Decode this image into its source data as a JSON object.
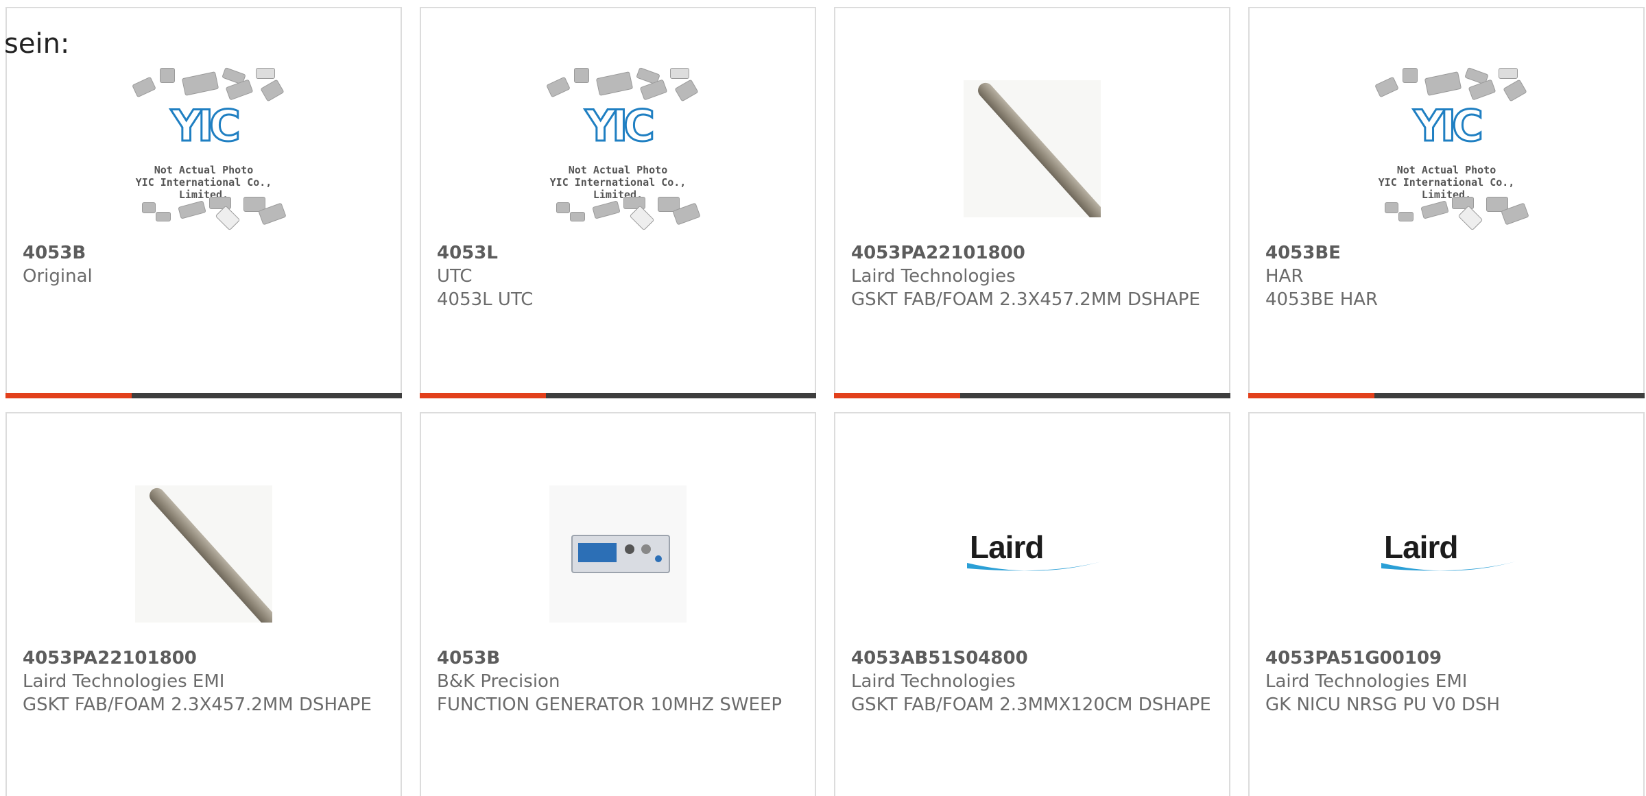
{
  "lead_text": "sein:",
  "placeholder": {
    "line1": "Not Actual Photo",
    "line2": "YIC International Co., Limited.",
    "logo": "YIC"
  },
  "logo_brand": "Laird",
  "colors": {
    "accent": "#e2401c",
    "bar": "#3e3e3e",
    "border": "#dcdcdc",
    "text": "#6b6b6b",
    "yic_blue": "#1f7fc2"
  },
  "products": [
    {
      "part": "4053B",
      "manufacturer": "Original",
      "desc": "",
      "image": "yic-placeholder"
    },
    {
      "part": "4053L",
      "manufacturer": "UTC",
      "desc": "4053L UTC",
      "image": "yic-placeholder"
    },
    {
      "part": "4053PA22101800",
      "manufacturer": "Laird Technologies",
      "desc": "GSKT FAB/FOAM 2.3X457.2MM DSHAPE",
      "image": "gasket-cable-photo"
    },
    {
      "part": "4053BE",
      "manufacturer": "HAR",
      "desc": "4053BE HAR",
      "image": "yic-placeholder"
    },
    {
      "part": "4053PA22101800",
      "manufacturer": "Laird Technologies EMI",
      "desc": "GSKT FAB/FOAM 2.3X457.2MM DSHAPE",
      "image": "gasket-cable-photo"
    },
    {
      "part": "4053B",
      "manufacturer": "B&K Precision",
      "desc": "FUNCTION GENERATOR 10MHZ SWEEP",
      "image": "function-generator-photo"
    },
    {
      "part": "4053AB51S04800",
      "manufacturer": "Laird Technologies",
      "desc": "GSKT FAB/FOAM 2.3MMX120CM DSHAPE",
      "image": "laird-logo"
    },
    {
      "part": "4053PA51G00109",
      "manufacturer": "Laird Technologies EMI",
      "desc": "GK NICU NRSG PU V0 DSH",
      "image": "laird-logo"
    }
  ]
}
